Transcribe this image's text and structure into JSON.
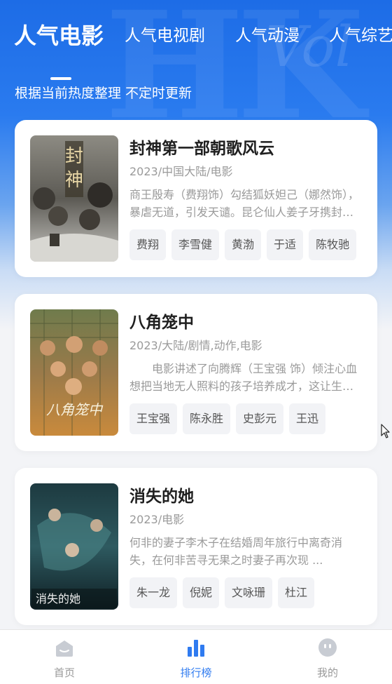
{
  "tabs": [
    {
      "label": "人气电影",
      "active": true
    },
    {
      "label": "人气电视剧",
      "active": false
    },
    {
      "label": "人气动漫",
      "active": false
    },
    {
      "label": "人气综艺",
      "active": false
    }
  ],
  "subtitle": "根据当前热度整理 不定时更新",
  "movies": [
    {
      "title": "封神第一部朝歌风云",
      "meta": "2023/中国大陆/电影",
      "description": "商王殷寿（费翔饰）勾结狐妖妲己（娜然饰），暴虐无道，引发天谴。昆仑仙人姜子牙携封神榜下山",
      "tags": [
        "费翔",
        "李雪健",
        "黄渤",
        "于适",
        "陈牧驰"
      ]
    },
    {
      "title": "八角笼中",
      "meta": "2023/大陆/剧情,动作,电影",
      "description": "电影讲述了向腾辉（王宝强 饰）倾注心血想把当地无人照料的孩子培养成才，这让生活陷入困境的孩子们看到了希望",
      "tags": [
        "王宝强",
        "陈永胜",
        "史彭元",
        "王迅"
      ]
    },
    {
      "title": "消失的她",
      "meta": "2023/电影",
      "description": "何非的妻子李木子在结婚周年旅行中离奇消失，在何非苦寻无果之时妻子再次现 ...",
      "tags": [
        "朱一龙",
        "倪妮",
        "文咏珊",
        "杜江"
      ]
    }
  ],
  "bottom_nav": [
    {
      "label": "首页",
      "icon": "home-icon",
      "active": false
    },
    {
      "label": "排行榜",
      "icon": "ranking-icon",
      "active": true
    },
    {
      "label": "我的",
      "icon": "profile-icon",
      "active": false
    }
  ],
  "colors": {
    "accent": "#2f7bf0",
    "hero": "#1d6ce6"
  }
}
